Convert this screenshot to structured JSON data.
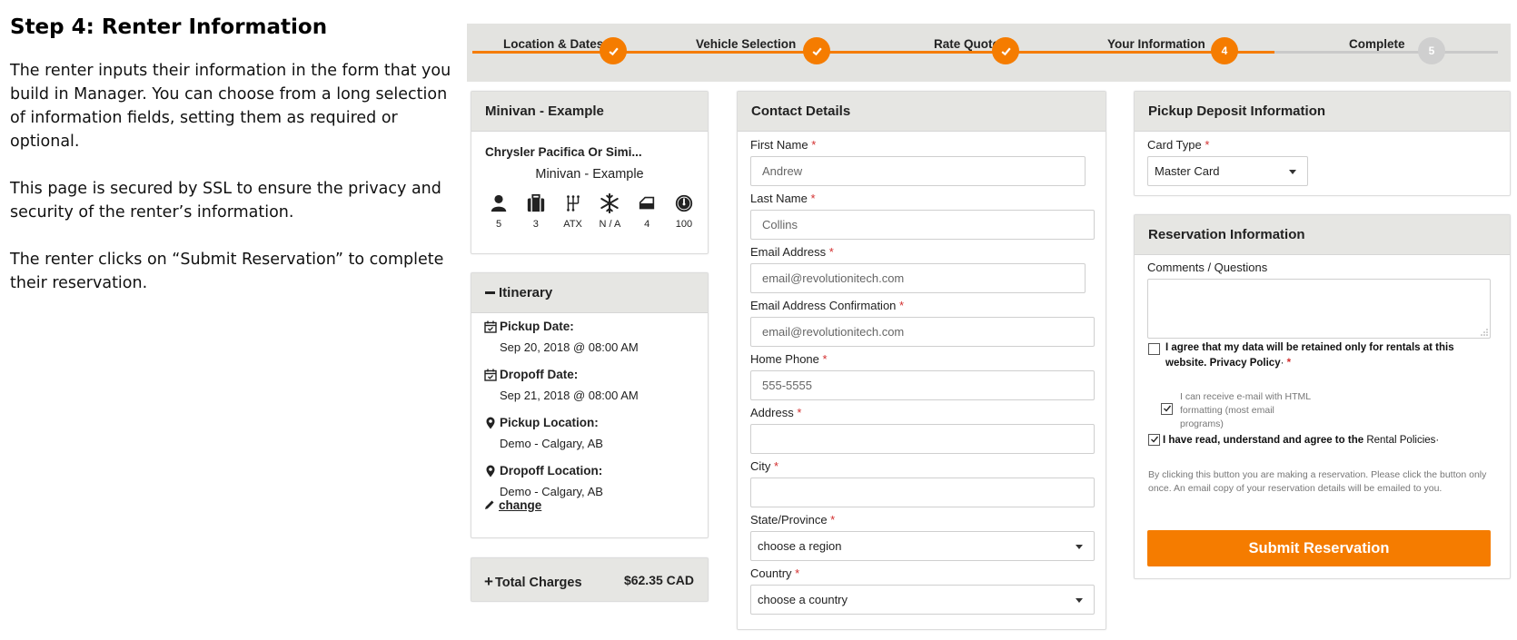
{
  "intro": {
    "title": "Step 4: Renter Information",
    "p1": "The renter inputs their information in the form that you build in Manager. You can choose from a long selection of information fields, setting them as required or optional.",
    "p2": "This page is secured by SSL to ensure the privacy and security of the renter’s information.",
    "p3": "The renter clicks on “Submit Reservation” to complete their reservation."
  },
  "progress": {
    "steps": [
      {
        "label": "Location & Dates",
        "state": "done"
      },
      {
        "label": "Vehicle Selection",
        "state": "done"
      },
      {
        "label": "Rate Quote",
        "state": "done"
      },
      {
        "label": "Your Information",
        "state": "current",
        "number": "4"
      },
      {
        "label": "Complete",
        "state": "todo",
        "number": "5"
      }
    ],
    "colors": {
      "accent": "#f57c00",
      "todo": "#cfcfcf"
    }
  },
  "vehicle": {
    "title": "Minivan - Example",
    "model": "Chrysler Pacifica Or Simi...",
    "class": "Minivan - Example",
    "specs": [
      {
        "icon": "passenger-icon",
        "value": "5"
      },
      {
        "icon": "luggage-icon",
        "value": "3"
      },
      {
        "icon": "transmission-icon",
        "value": "ATX"
      },
      {
        "icon": "air-conditioning-icon",
        "value": "N / A"
      },
      {
        "icon": "door-icon",
        "value": "4"
      },
      {
        "icon": "mileage-icon",
        "value": "100"
      }
    ]
  },
  "itinerary": {
    "title": "Itinerary",
    "pickup_date_label": "Pickup Date:",
    "pickup_date": "Sep 20, 2018 @ 08:00 AM",
    "dropoff_date_label": "Dropoff Date:",
    "dropoff_date": "Sep 21, 2018 @ 08:00 AM",
    "pickup_location_label": "Pickup Location:",
    "pickup_location": "Demo - Calgary, AB",
    "dropoff_location_label": "Dropoff Location:",
    "dropoff_location": "Demo - Calgary, AB",
    "change_label": "change"
  },
  "totals": {
    "label": "Total Charges",
    "amount": "$62.35 CAD"
  },
  "contact": {
    "title": "Contact Details",
    "first_name_label": "First Name",
    "first_name_value": "Andrew",
    "last_name_label": "Last Name",
    "last_name_value": "Collins",
    "email_label": "Email Address",
    "email_value": "email@revolutionitech.com",
    "email_confirm_label": "Email Address Confirmation",
    "email_confirm_value": "email@revolutionitech.com",
    "home_phone_label": "Home Phone",
    "home_phone_value": "555-5555",
    "address_label": "Address",
    "address_value": "",
    "city_label": "City",
    "city_value": "",
    "state_label": "State/Province",
    "state_value": "choose a region",
    "country_label": "Country",
    "country_value": "choose a country",
    "required_mark": "*"
  },
  "deposit": {
    "title": "Pickup Deposit Information",
    "card_type_label": "Card Type",
    "card_type_value": "Master Card"
  },
  "reservation": {
    "title": "Reservation Information",
    "comments_label": "Comments / Questions",
    "agree_data_text": "I agree that my data will be retained only for rentals at this website.",
    "privacy_policy": "Privacy Policy",
    "html_email_text": "I can receive e-mail with HTML formatting (most email programs)",
    "agree_policies_text": "I have read, understand and agree to the",
    "rental_policies": "Rental Policies",
    "disclaimer": "By clicking this button you are making a reservation. Please click the button only once. An email copy of your reservation details will be emailed to you.",
    "submit_label": "Submit Reservation",
    "agree_data_checked": false,
    "html_email_checked": true,
    "agree_policies_checked": true
  }
}
